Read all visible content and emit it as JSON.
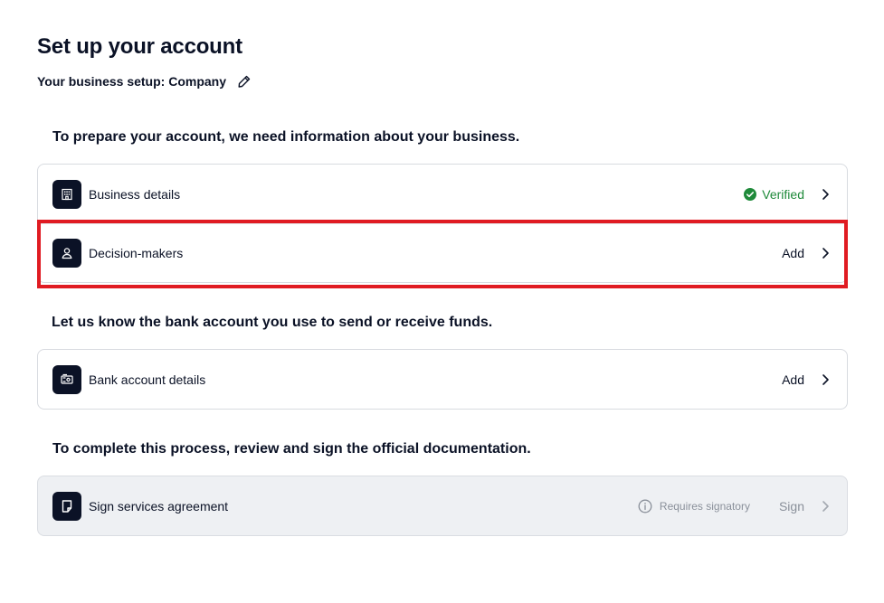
{
  "header": {
    "title": "Set up your account",
    "business_setup": "Your business setup: Company"
  },
  "sections": [
    {
      "heading": "To prepare your account, we need information about your business.",
      "items": [
        {
          "label": "Business details",
          "icon": "building-icon",
          "status": "Verified"
        },
        {
          "label": "Decision-makers",
          "icon": "person-icon",
          "action": "Add"
        }
      ]
    },
    {
      "heading": "Let us know the bank account you use to send or receive funds.",
      "items": [
        {
          "label": "Bank account details",
          "icon": "bank-card-icon",
          "action": "Add"
        }
      ]
    },
    {
      "heading": "To complete this process, review and sign the official documentation.",
      "items": [
        {
          "label": "Sign services agreement",
          "icon": "document-icon",
          "note": "Requires signatory",
          "action": "Sign"
        }
      ]
    }
  ],
  "colors": {
    "icon_bg": "#0b1226",
    "verified": "#1f8a3a",
    "highlight": "#e01b22",
    "disabled_bg": "#eef0f3",
    "muted_text": "#8a909a"
  }
}
